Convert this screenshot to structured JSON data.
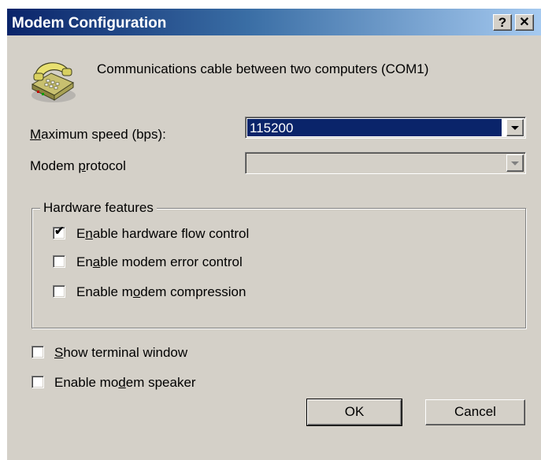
{
  "window": {
    "title": "Modem Configuration",
    "help_button": "?",
    "close_button": "✕"
  },
  "description": "Communications cable between two computers (COM1)",
  "speed": {
    "label_pre": "",
    "label_u": "M",
    "label_post": "aximum speed (bps):",
    "value": "115200"
  },
  "protocol": {
    "label_pre": "Modem ",
    "label_u": "p",
    "label_post": "rotocol",
    "value": ""
  },
  "hardware": {
    "title": "Hardware features",
    "items": [
      {
        "pre": "E",
        "u": "n",
        "post": "able hardware flow control",
        "checked": true
      },
      {
        "pre": "En",
        "u": "a",
        "post": "ble modem error control",
        "checked": false
      },
      {
        "pre": "Enable m",
        "u": "o",
        "post": "dem compression",
        "checked": false
      }
    ]
  },
  "options": [
    {
      "pre": "",
      "u": "S",
      "post": "how terminal window",
      "checked": false
    },
    {
      "pre": "Enable mo",
      "u": "d",
      "post": "em speaker",
      "checked": false
    }
  ],
  "buttons": {
    "ok": "OK",
    "cancel": "Cancel"
  },
  "colors": {
    "titlebar": "#0a246a",
    "face": "#d4d0c8",
    "selection": "#0a246a"
  },
  "icons": {
    "dialog": "telephone-icon",
    "check": "✔"
  }
}
